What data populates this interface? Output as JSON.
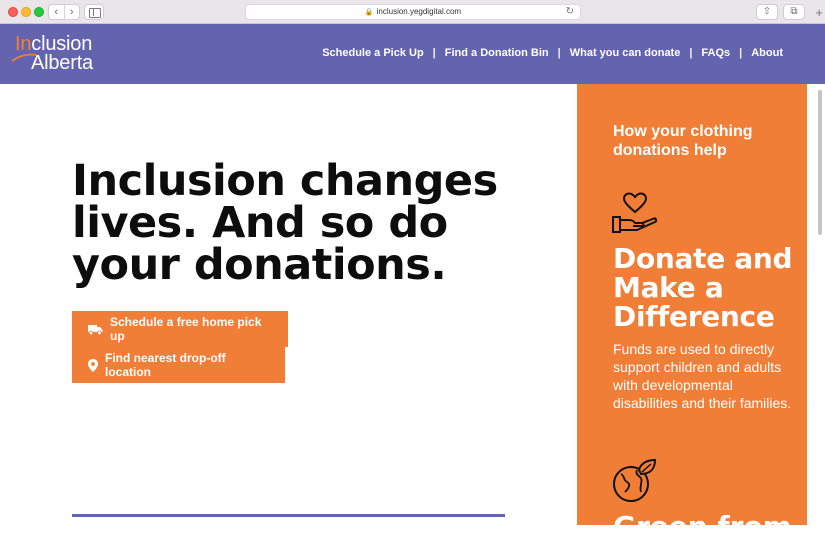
{
  "browser": {
    "url": "inclusion.yegdigital.com",
    "back_glyph": "‹",
    "forward_glyph": "›",
    "lock_glyph": "🔒",
    "reload_glyph": "↻",
    "share_glyph": "⇧",
    "tabs_glyph": "⧉",
    "newtab_glyph": "+"
  },
  "site": {
    "logo": {
      "line1_accent": "In",
      "line1_rest": "clusion",
      "line2": "Alberta"
    },
    "nav": [
      {
        "label": "Schedule a Pick Up"
      },
      {
        "label": "Find a Donation Bin"
      },
      {
        "label": "What you can donate"
      },
      {
        "label": "FAQs"
      },
      {
        "label": "About"
      }
    ],
    "nav_separator": "|"
  },
  "hero": {
    "headline": "Inclusion changes lives. And so do your donations.",
    "cta_pickup": "Schedule a free home pick up",
    "cta_dropoff": "Find nearest drop-off location"
  },
  "panel": {
    "title": "How your clothing donations help",
    "item1_title": "Donate and Make a Difference",
    "item1_text": "Funds are used to directly support children and adults with developmental disabilities and their families.",
    "item2_title": "Green from"
  },
  "colors": {
    "brand_purple": "#6463ae",
    "brand_orange": "#f07e36",
    "text_dark": "#0d0d0d"
  },
  "icons": [
    "truck-icon",
    "location-pin-icon",
    "heart-hand-icon",
    "earth-leaf-icon",
    "lock-icon",
    "reload-icon"
  ]
}
